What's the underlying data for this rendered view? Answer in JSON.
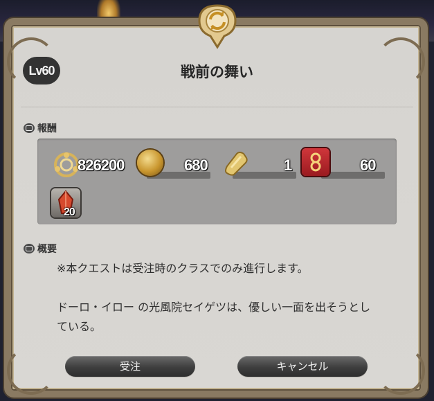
{
  "dialog": {
    "level_badge": "Lv60",
    "title": "戦前の舞い"
  },
  "rewards": {
    "section_label": "報酬",
    "gil": "826200",
    "allied_seals": "680",
    "item_bar_count": "1",
    "tomestones": "60",
    "crystal_count": "20"
  },
  "overview": {
    "section_label": "概要",
    "line1": "※本クエストは受注時のクラスでのみ進行します。",
    "line2": "ドーロ・イロー の光風院セイゲツは、優しい一面を出そうとし",
    "line3": "ている。"
  },
  "buttons": {
    "accept_label": "受注",
    "cancel_label": "キャンセル"
  },
  "colors": {
    "frame": "#8a7a62",
    "panel": "#d6d4d0",
    "reward_panel": "#9e9d9c",
    "gold": "#d9a93a",
    "tomestone_red": "#b21f24"
  }
}
